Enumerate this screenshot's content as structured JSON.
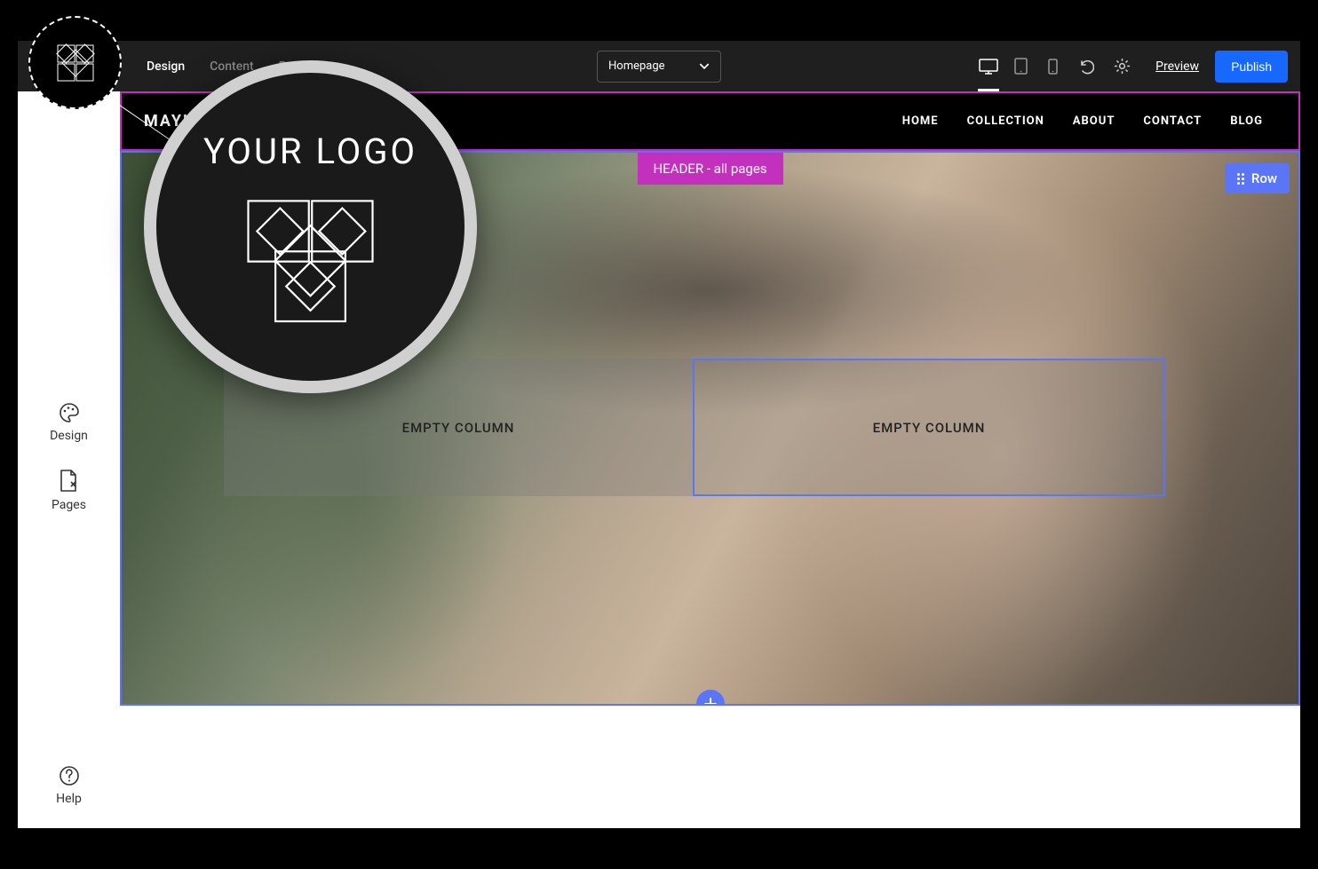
{
  "topbar": {
    "tabs": [
      {
        "label": "Design",
        "active": true
      },
      {
        "label": "Content",
        "active": false
      },
      {
        "label": "Products",
        "active": false,
        "hasChevron": true
      }
    ],
    "page_select_label": "Homepage",
    "preview_label": "Preview",
    "publish_label": "Publish"
  },
  "sidebar": {
    "items": [
      {
        "icon": "palette-icon",
        "label": "Design"
      },
      {
        "icon": "page-icon",
        "label": "Pages"
      }
    ],
    "help_label": "Help"
  },
  "site": {
    "brand": "MAYLI",
    "nav": [
      "HOME",
      "COLLECTION",
      "ABOUT",
      "CONTACT",
      "BLOG"
    ]
  },
  "editor": {
    "header_badge": "HEADER - all pages",
    "row_badge": "Row",
    "empty_column_label_1": "EMPTY COLUMN",
    "empty_column_label_2": "EMPTY COLUMN"
  },
  "callout": {
    "your_logo_text": "YOUR LOGO"
  },
  "colors": {
    "accent_blue": "#5b75f7",
    "accent_magenta": "#c330be",
    "primary_blue": "#1768ff"
  }
}
